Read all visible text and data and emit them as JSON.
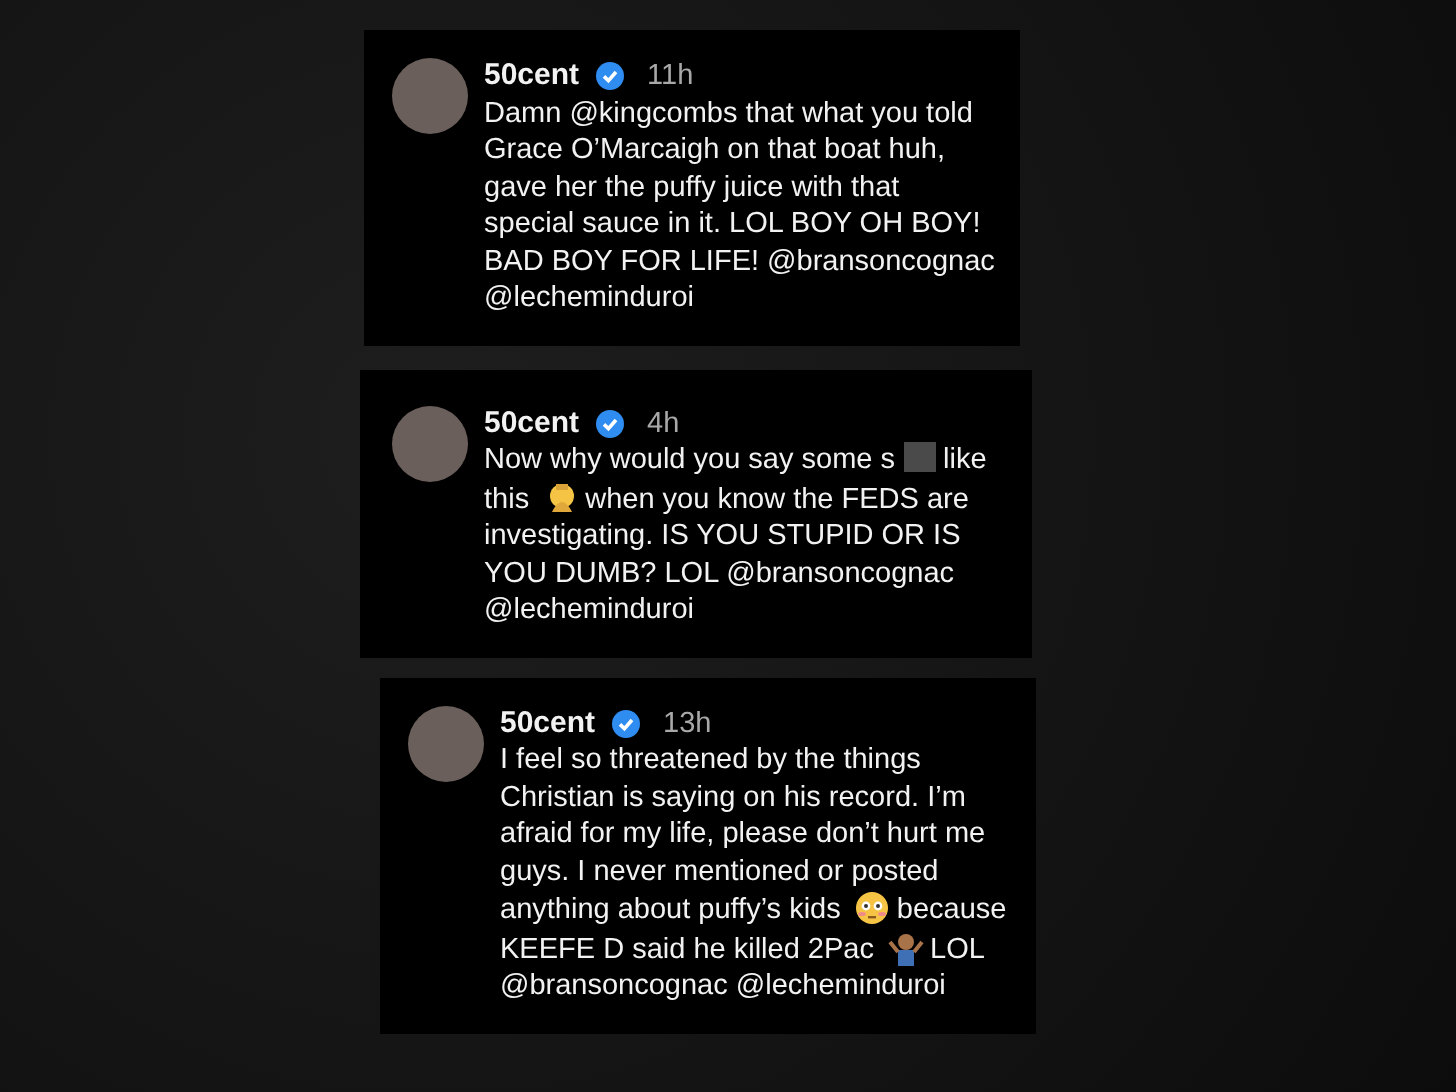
{
  "comments": [
    {
      "username": "50cent",
      "verified": true,
      "time": "11h",
      "parts": [
        {
          "kind": "text",
          "text": "Damn @kingcombs that what you told Grace O’Marcaigh on that boat huh, gave her the puffy juice with that special sauce in it. LOL BOY OH BOY! BAD BOY FOR LIFE! @bransoncognac @lecheminduroi"
        }
      ]
    },
    {
      "username": "50cent",
      "verified": true,
      "time": "4h",
      "parts": [
        {
          "kind": "text",
          "text": "Now why would you say some s"
        },
        {
          "kind": "censor"
        },
        {
          "kind": "text",
          "text": "like this"
        },
        {
          "kind": "facepalm"
        },
        {
          "kind": "text",
          "text": "when you know the FEDS are investigating. IS YOU STUPID OR IS YOU DUMB? LOL @bransoncognac @lecheminduroi"
        }
      ]
    },
    {
      "username": "50cent",
      "verified": true,
      "time": "13h",
      "parts": [
        {
          "kind": "text",
          "text": "I feel so threatened by the things Christian is saying on his record. I’m afraid for my life, please don’t hurt me guys. I never mentioned or posted anything about puffy’s kids"
        },
        {
          "kind": "flushed"
        },
        {
          "kind": "text",
          "text": "because KEEFE D said he killed 2Pac"
        },
        {
          "kind": "shrug"
        },
        {
          "kind": "text",
          "text": "LOL @bransoncognac @lecheminduroi"
        }
      ]
    }
  ]
}
